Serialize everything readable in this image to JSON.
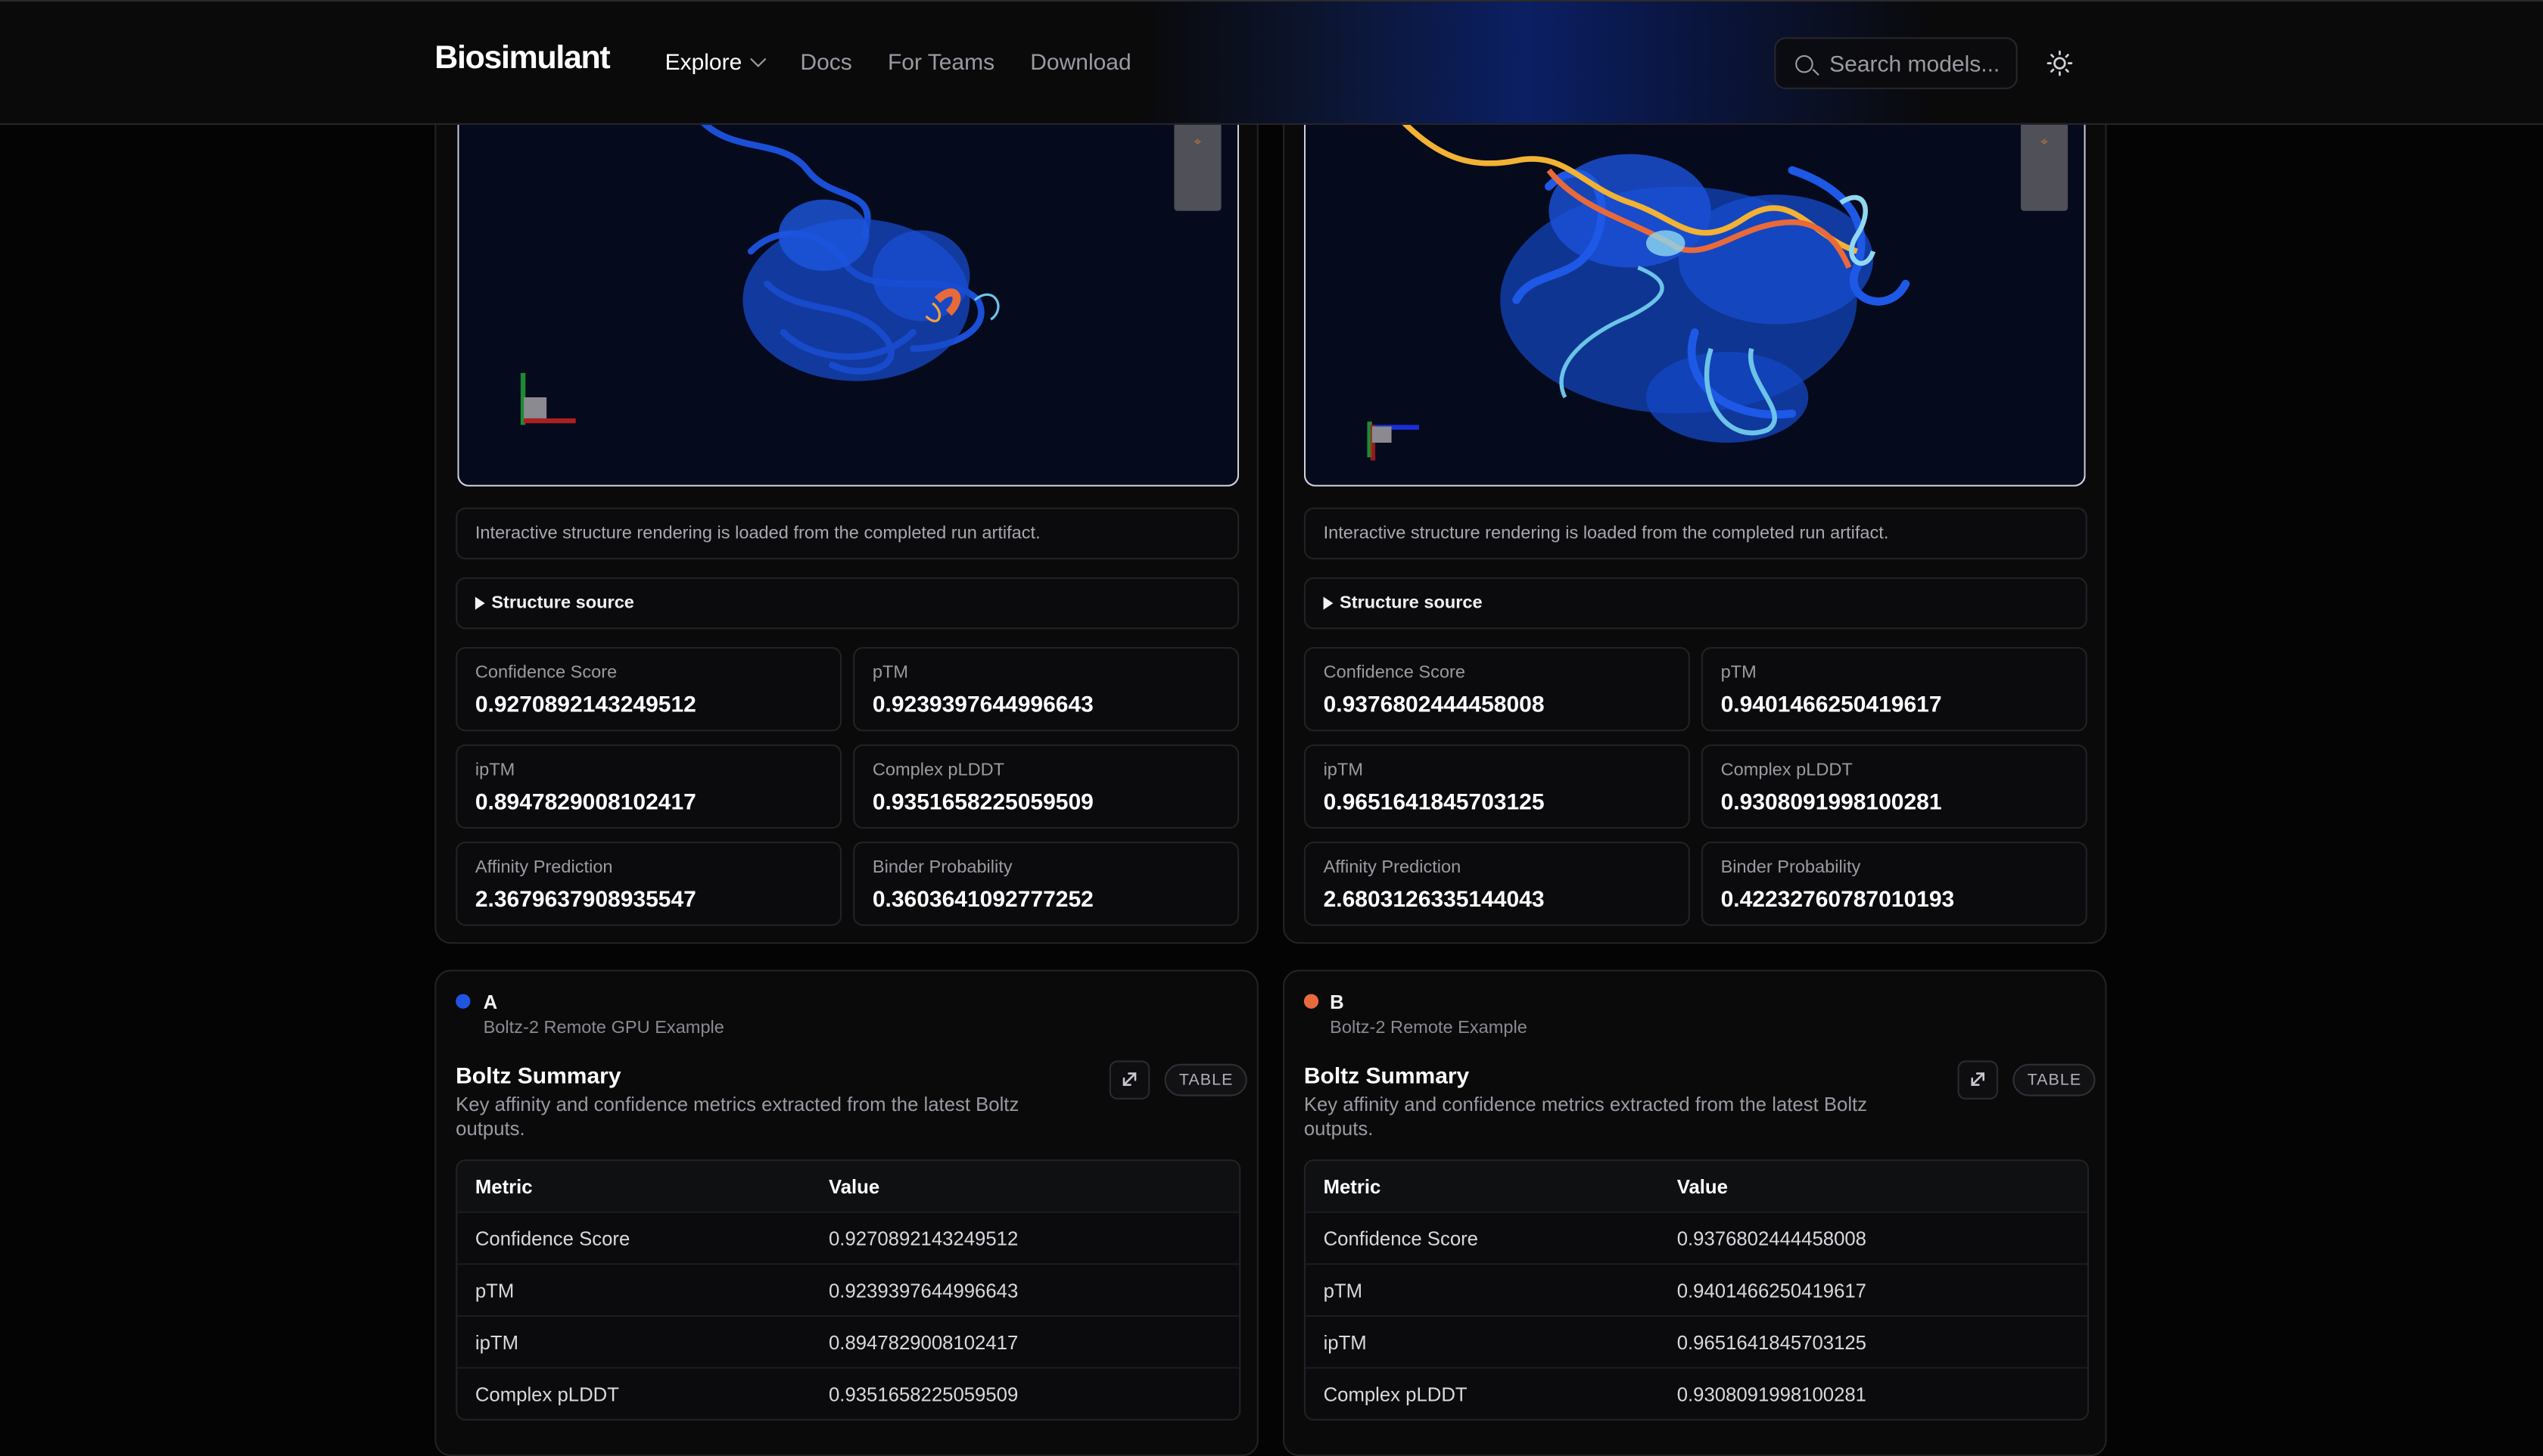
{
  "header": {
    "logo": "Biosimulant",
    "nav": [
      "Explore",
      "Docs",
      "For Teams",
      "Download"
    ],
    "search_placeholder": "Search models..."
  },
  "panels": [
    {
      "info": "Interactive structure rendering is loaded from the completed run artifact.",
      "source_label": "Structure source",
      "metrics": [
        {
          "label": "Confidence Score",
          "value": "0.9270892143249512"
        },
        {
          "label": "pTM",
          "value": "0.9239397644996643"
        },
        {
          "label": "ipTM",
          "value": "0.8947829008102417"
        },
        {
          "label": "Complex pLDDT",
          "value": "0.9351658225059509"
        },
        {
          "label": "Affinity Prediction",
          "value": "2.3679637908935547"
        },
        {
          "label": "Binder Probability",
          "value": "0.3603641092777252"
        }
      ],
      "series_label": "A",
      "series_color": "#1f55e0",
      "series_sub": "Boltz-2 Remote GPU Example",
      "summary_title": "Boltz Summary",
      "summary_desc": "Key affinity and confidence metrics extracted from the latest Boltz outputs.",
      "table_badge": "TABLE",
      "table_headers": [
        "Metric",
        "Value"
      ],
      "table_rows": [
        [
          "Confidence Score",
          "0.9270892143249512"
        ],
        [
          "pTM",
          "0.9239397644996643"
        ],
        [
          "ipTM",
          "0.8947829008102417"
        ],
        [
          "Complex pLDDT",
          "0.9351658225059509"
        ]
      ]
    },
    {
      "info": "Interactive structure rendering is loaded from the completed run artifact.",
      "source_label": "Structure source",
      "metrics": [
        {
          "label": "Confidence Score",
          "value": "0.9376802444458008"
        },
        {
          "label": "pTM",
          "value": "0.9401466250419617"
        },
        {
          "label": "ipTM",
          "value": "0.9651641845703125"
        },
        {
          "label": "Complex pLDDT",
          "value": "0.9308091998100281"
        },
        {
          "label": "Affinity Prediction",
          "value": "2.6803126335144043"
        },
        {
          "label": "Binder Probability",
          "value": "0.42232760787010193"
        }
      ],
      "series_label": "B",
      "series_color": "#e86a3a",
      "series_sub": "Boltz-2 Remote Example",
      "summary_title": "Boltz Summary",
      "summary_desc": "Key affinity and confidence metrics extracted from the latest Boltz outputs.",
      "table_badge": "TABLE",
      "table_headers": [
        "Metric",
        "Value"
      ],
      "table_rows": [
        [
          "Confidence Score",
          "0.9376802444458008"
        ],
        [
          "pTM",
          "0.9401466250419617"
        ],
        [
          "ipTM",
          "0.9651641845703125"
        ],
        [
          "Complex pLDDT",
          "0.9308091998100281"
        ]
      ]
    }
  ]
}
